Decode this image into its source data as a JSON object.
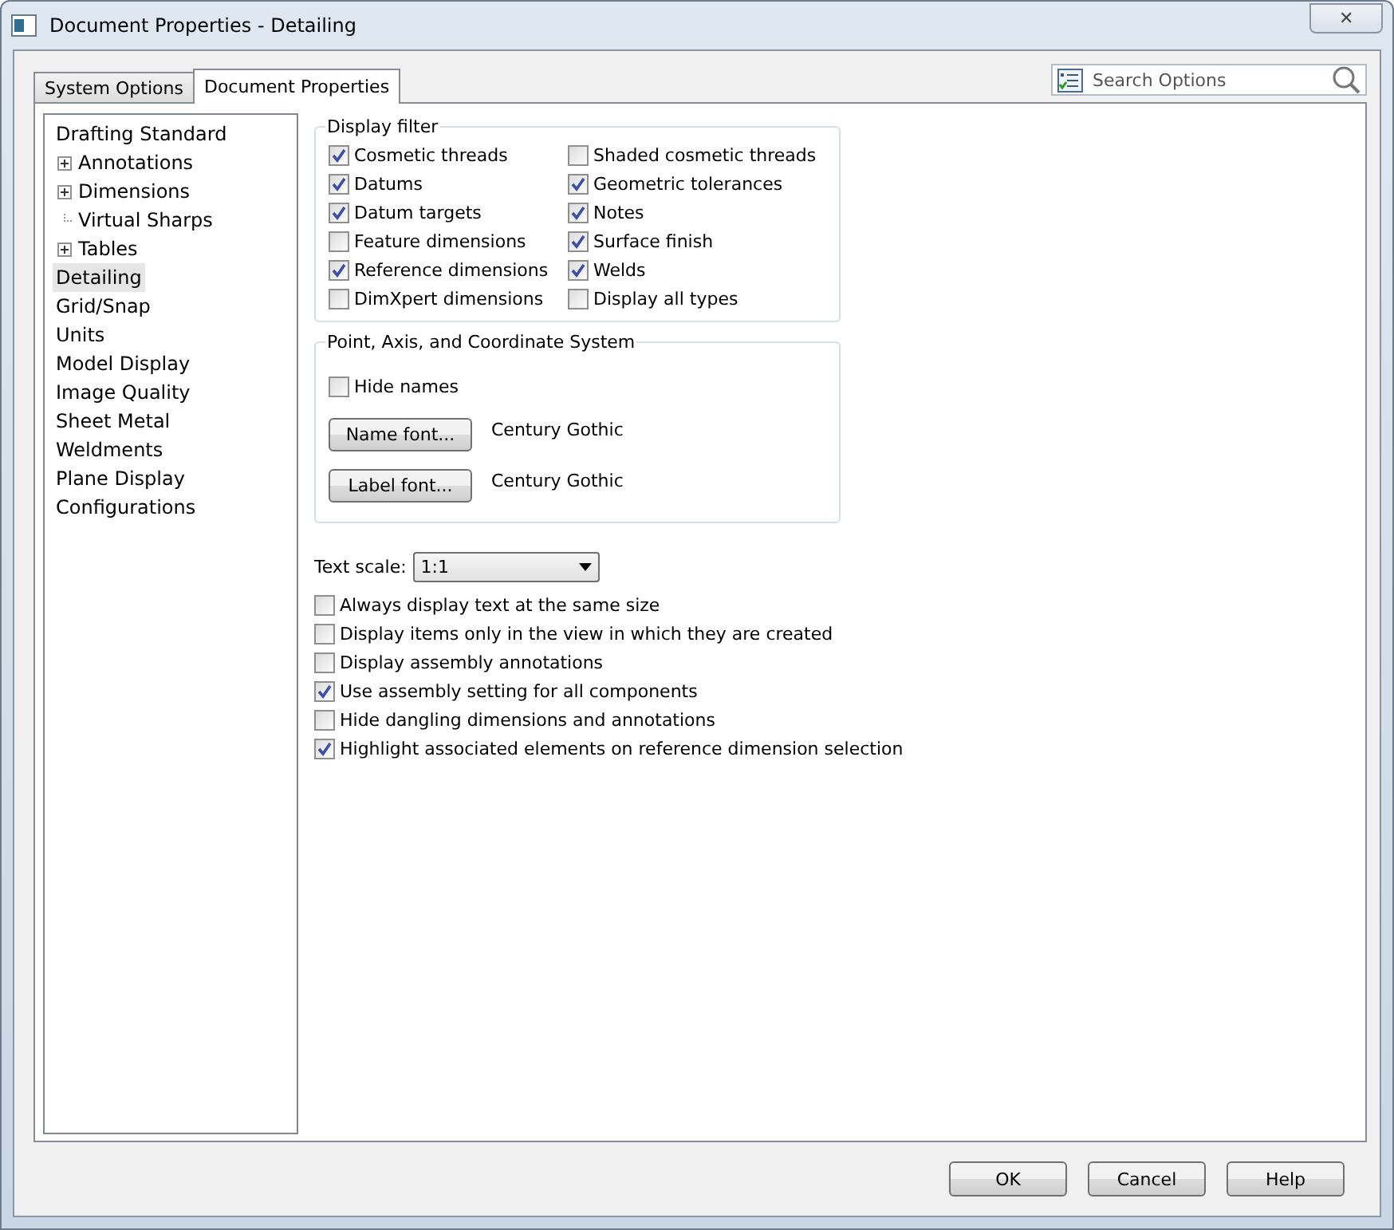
{
  "window": {
    "title": "Document Properties - Detailing",
    "close_label": "✕"
  },
  "tabs": [
    {
      "label": "System Options",
      "selected": false
    },
    {
      "label": "Document Properties",
      "selected": true
    }
  ],
  "search": {
    "placeholder": "Search Options"
  },
  "tree": [
    {
      "label": "Drafting Standard",
      "selected": false,
      "children": [
        {
          "label": "Annotations",
          "kind": "expandable",
          "selected": false
        },
        {
          "label": "Dimensions",
          "kind": "expandable",
          "selected": false
        },
        {
          "label": "Virtual Sharps",
          "kind": "leaf",
          "selected": false
        },
        {
          "label": "Tables",
          "kind": "expandable",
          "selected": false
        }
      ]
    },
    {
      "label": "Detailing",
      "selected": true
    },
    {
      "label": "Grid/Snap",
      "selected": false
    },
    {
      "label": "Units",
      "selected": false
    },
    {
      "label": "Model Display",
      "selected": false
    },
    {
      "label": "Image Quality",
      "selected": false
    },
    {
      "label": "Sheet Metal",
      "selected": false
    },
    {
      "label": "Weldments",
      "selected": false
    },
    {
      "label": "Plane Display",
      "selected": false
    },
    {
      "label": "Configurations",
      "selected": false
    }
  ],
  "display_filter": {
    "title": "Display filter",
    "items": [
      {
        "label": "Cosmetic threads",
        "checked": true
      },
      {
        "label": "Shaded cosmetic threads",
        "checked": false
      },
      {
        "label": "Datums",
        "checked": true
      },
      {
        "label": "Geometric tolerances",
        "checked": true
      },
      {
        "label": "Datum targets",
        "checked": true
      },
      {
        "label": "Notes",
        "checked": true
      },
      {
        "label": "Feature dimensions",
        "checked": false
      },
      {
        "label": "Surface finish",
        "checked": true
      },
      {
        "label": "Reference dimensions",
        "checked": true
      },
      {
        "label": "Welds",
        "checked": true
      },
      {
        "label": "DimXpert dimensions",
        "checked": false
      },
      {
        "label": "Display all types",
        "checked": false
      }
    ]
  },
  "point_axis": {
    "title": "Point, Axis, and Coordinate System",
    "hide_names": {
      "label": "Hide names",
      "checked": false
    },
    "fonts": [
      {
        "button": "Name font...",
        "value": "Century Gothic"
      },
      {
        "button": "Label font...",
        "value": "Century Gothic"
      }
    ]
  },
  "text_scale": {
    "label": "Text scale:",
    "value": "1:1"
  },
  "options": [
    {
      "label": "Always display text at the same size",
      "checked": false
    },
    {
      "label": "Display items only in the view in which they are created",
      "checked": false
    },
    {
      "label": "Display assembly annotations",
      "checked": false
    },
    {
      "label": "Use assembly setting for all components",
      "checked": true
    },
    {
      "label": "Hide dangling dimensions and annotations",
      "checked": false
    },
    {
      "label": "Highlight associated elements on reference dimension selection",
      "checked": true
    }
  ],
  "buttons": [
    "OK",
    "Cancel",
    "Help"
  ]
}
